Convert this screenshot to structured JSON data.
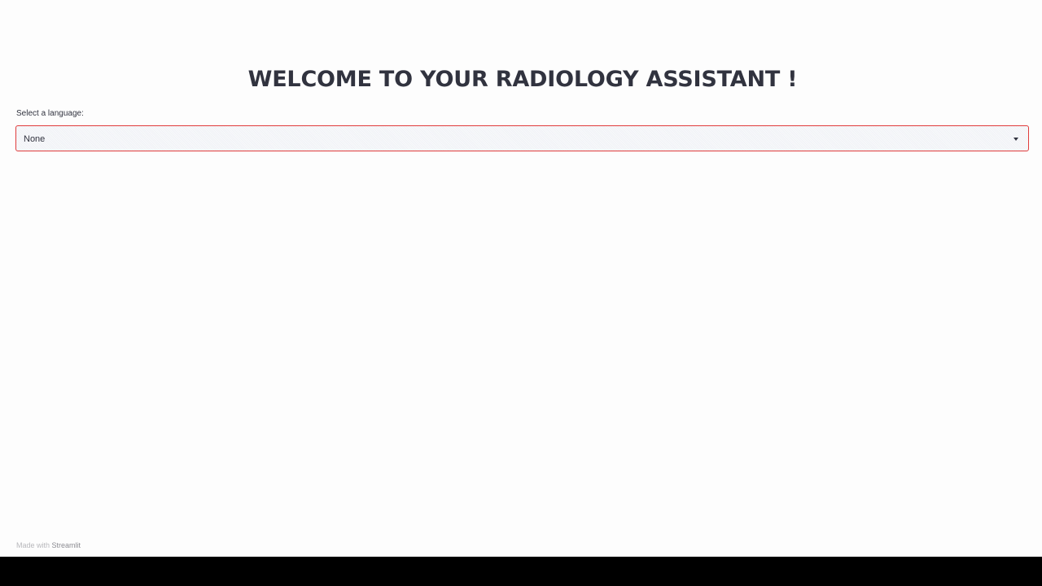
{
  "header": {
    "title": "WELCOME TO YOUR RADIOLOGY ASSISTANT !"
  },
  "language_select": {
    "label": "Select a language:",
    "selected_value": "None",
    "icon": "chevron-down-icon",
    "border_color": "#e03c3c"
  },
  "footer": {
    "prefix": "Made with",
    "brand": "Streamlit"
  },
  "colors": {
    "background": "#fdfdfd",
    "text": "#31333f",
    "accent": "#e03c3c"
  }
}
